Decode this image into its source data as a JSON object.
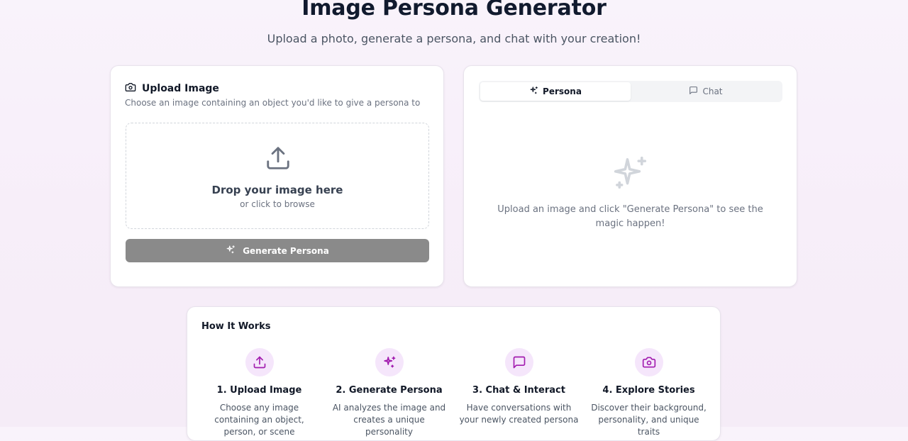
{
  "header": {
    "title": "Image Persona Generator",
    "subtitle": "Upload a photo, generate a persona, and chat with your creation!"
  },
  "upload_card": {
    "title": "Upload Image",
    "description": "Choose an image containing an object you'd like to give a persona to",
    "icon": "camera-icon",
    "dropzone": {
      "title": "Drop your image here",
      "subtitle": "or click to browse",
      "icon": "upload-icon"
    },
    "generate_button": {
      "label": "Generate Persona",
      "icon": "sparkles-icon",
      "color": "#8a8a8a"
    }
  },
  "persona_card": {
    "tabs": [
      {
        "label": "Persona",
        "icon": "sparkles-icon",
        "active": true
      },
      {
        "label": "Chat",
        "icon": "message-square-icon",
        "active": false
      }
    ],
    "empty_state": {
      "icon": "sparkle-icon",
      "text": "Upload an image and click \"Generate Persona\" to see the magic happen!"
    }
  },
  "how_it_works": {
    "title": "How It Works",
    "accent_color": "#a21caf",
    "steps": [
      {
        "icon": "upload-icon",
        "title": "1. Upload Image",
        "description": "Choose any image containing an object, person, or scene"
      },
      {
        "icon": "sparkles-icon",
        "title": "2. Generate Persona",
        "description": "AI analyzes the image and creates a unique personality"
      },
      {
        "icon": "message-square-icon",
        "title": "3. Chat & Interact",
        "description": "Have conversations with your newly created persona"
      },
      {
        "icon": "camera-icon",
        "title": "4. Explore Stories",
        "description": "Discover their background, personality, and unique traits"
      }
    ]
  }
}
